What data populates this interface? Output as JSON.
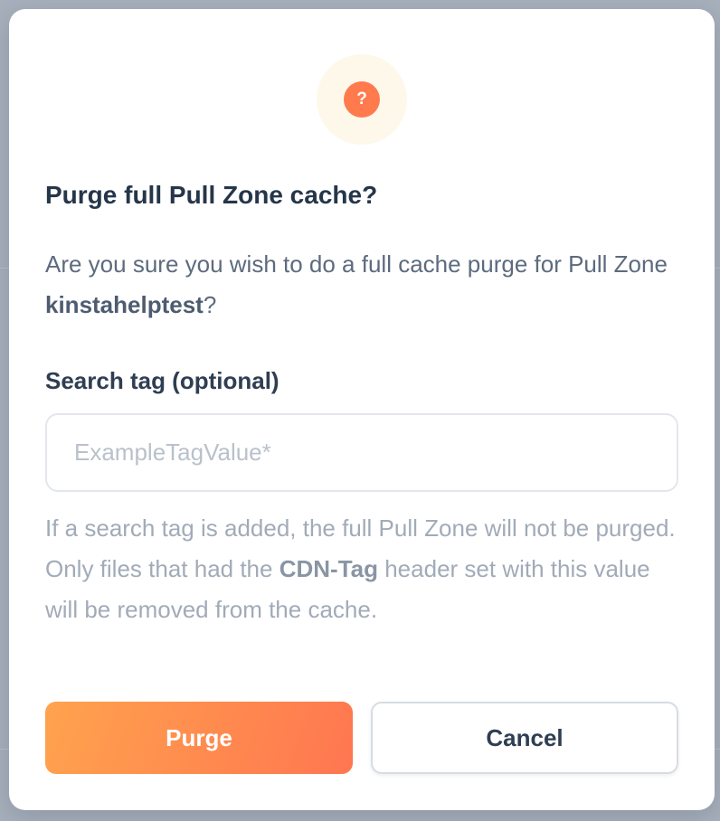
{
  "dialog": {
    "icon": "question-mark-icon",
    "icon_glyph": "?",
    "title": "Purge full Pull Zone cache?",
    "question_prefix": "Are you sure you wish to do a full cache purge for Pull Zone ",
    "pull_zone_name": "kinstahelptest",
    "question_suffix": "?",
    "search_tag_label": "Search tag (optional)",
    "search_tag_placeholder": "ExampleTagValue*",
    "search_tag_value": "",
    "help_prefix": "If a search tag is added, the full Pull Zone will not be purged. Only files that had the ",
    "help_header_name": "CDN-Tag",
    "help_suffix": " header set with this value will be removed from the cache.",
    "purge_label": "Purge",
    "cancel_label": "Cancel"
  },
  "colors": {
    "accent": "#ff7a4d",
    "purge_gradient_start": "#ffa34e",
    "purge_gradient_end": "#ff7650",
    "title": "#26364a",
    "backdrop": "#a7b0bc"
  }
}
